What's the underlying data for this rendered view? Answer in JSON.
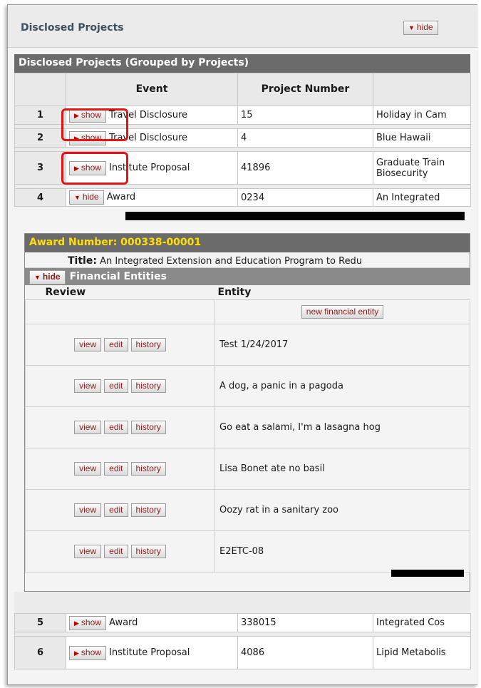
{
  "panel": {
    "title": "Disclosed Projects",
    "hide_label": "hide"
  },
  "group": {
    "title": "Disclosed Projects (Grouped by Projects)"
  },
  "table": {
    "headers": {
      "event": "Event",
      "project_number": "Project Number"
    },
    "rows": [
      {
        "num": "1",
        "toggle": "show",
        "event": "Travel Disclosure",
        "project_number": "15",
        "title": "Holiday in Cam"
      },
      {
        "num": "2",
        "toggle": "show",
        "event": "Travel Disclosure",
        "project_number": "4",
        "title": "Blue Hawaii"
      },
      {
        "num": "3",
        "toggle": "show",
        "event": "Institute Proposal",
        "project_number": "41896",
        "title": "Graduate Train Biosecurity"
      },
      {
        "num": "4",
        "toggle": "hide",
        "event": "Award",
        "project_number": "0234",
        "title": "An Integrated"
      },
      {
        "num": "5",
        "toggle": "show",
        "event": "Award",
        "project_number": "338015",
        "title": "Integrated Cos"
      },
      {
        "num": "6",
        "toggle": "show",
        "event": "Institute Proposal",
        "project_number": "4086",
        "title": "Lipid Metabolis"
      }
    ]
  },
  "award": {
    "header": "Award Number: 000338-00001",
    "title_label": "Title:",
    "title_value": "An Integrated Extension and Education Program to Redu",
    "financial_toggle": "hide",
    "financial_title": "Financial Entities",
    "col_review": "Review",
    "col_entity": "Entity",
    "new_entity_label": "new financial entity",
    "btn_view": "view",
    "btn_edit": "edit",
    "btn_history": "history",
    "entities": [
      "Test 1/24/2017",
      "A dog, a panic in a pagoda",
      "Go eat a salami, I'm a lasagna hog",
      "Lisa Bonet ate no basil",
      "Oozy rat in a sanitary zoo",
      "E2ETC-08"
    ]
  },
  "colors": {
    "highlight": "#e01515",
    "award_header_text": "#ffe000",
    "bar": "#6b6b6b"
  }
}
